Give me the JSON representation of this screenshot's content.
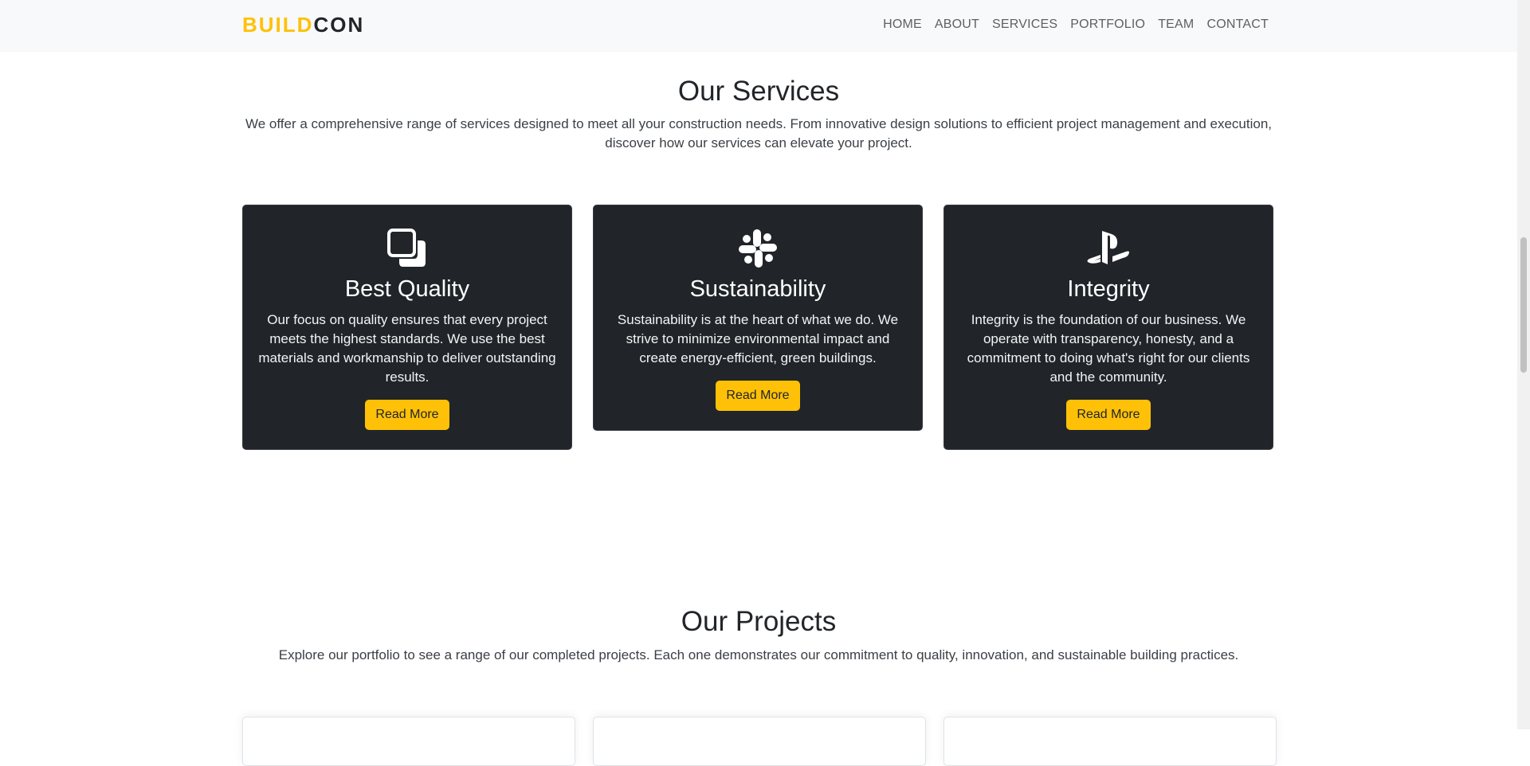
{
  "brand": {
    "part1": "BUILD",
    "part2": "CON"
  },
  "nav": [
    "HOME",
    "ABOUT",
    "SERVICES",
    "PORTFOLIO",
    "TEAM",
    "CONTACT"
  ],
  "services": {
    "title": "Our Services",
    "subtitle": "We offer a comprehensive range of services designed to meet all your construction needs. From innovative design solutions to efficient project management and execution, discover how our services can elevate your project.",
    "cards": [
      {
        "icon": "copy-icon",
        "title": "Best Quality",
        "text": "Our focus on quality ensures that every project meets the highest standards. We use the best materials and workmanship to deliver outstanding results.",
        "button": "Read More"
      },
      {
        "icon": "slack-icon",
        "title": "Sustainability",
        "text": "Sustainability is at the heart of what we do. We strive to minimize environmental impact and create energy-efficient, green buildings.",
        "button": "Read More"
      },
      {
        "icon": "playstation-icon",
        "title": "Integrity",
        "text": "Integrity is the foundation of our business. We operate with transparency, honesty, and a commitment to doing what's right for our clients and the community.",
        "button": "Read More"
      }
    ]
  },
  "projects": {
    "title": "Our Projects",
    "subtitle": "Explore our portfolio to see a range of our completed projects. Each one demonstrates our commitment to quality, innovation, and sustainable building practices."
  },
  "colors": {
    "accent": "#ffc107",
    "card_bg": "#212529",
    "navbar_bg": "#f8f9fa"
  }
}
